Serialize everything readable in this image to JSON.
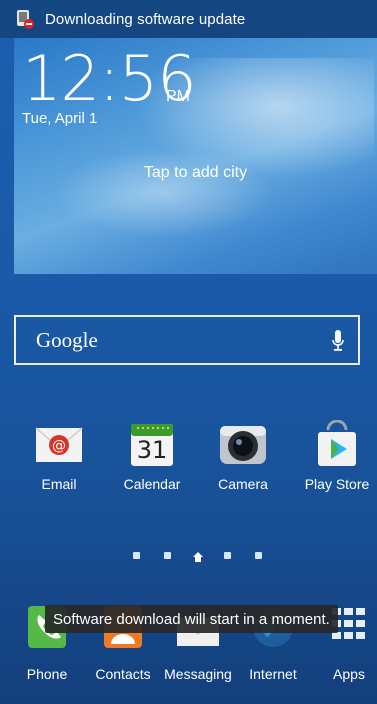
{
  "status_bar": {
    "title": "Downloading software update"
  },
  "clock": {
    "time": "12:56",
    "ampm": "PM",
    "date": "Tue, April 1"
  },
  "weather": {
    "add_city": "Tap to add city"
  },
  "search": {
    "label": "Google"
  },
  "apps": [
    {
      "label": "Email"
    },
    {
      "label": "Calendar",
      "day": "31"
    },
    {
      "label": "Camera"
    },
    {
      "label": "Play Store"
    }
  ],
  "dock": [
    {
      "label": "Phone"
    },
    {
      "label": "Contacts"
    },
    {
      "label": "Messaging"
    },
    {
      "label": "Internet"
    },
    {
      "label": "Apps"
    }
  ],
  "toast": {
    "text": "Software download will start in a moment."
  },
  "colors": {
    "accent_blue": "#1a5aa8",
    "email_red": "#d8342c",
    "calendar_green": "#3d9b2e"
  }
}
